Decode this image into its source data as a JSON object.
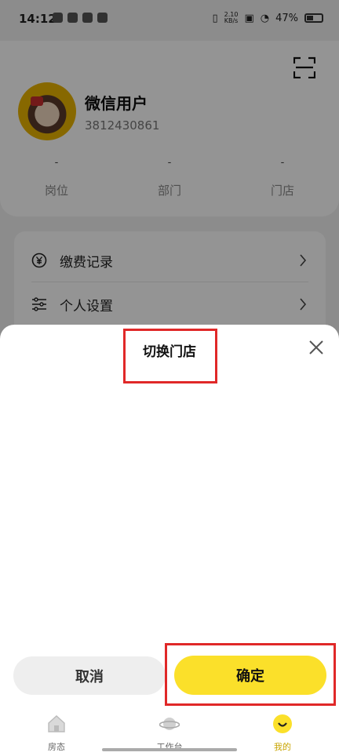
{
  "status_bar": {
    "time": "14:12",
    "net_speed": "2.10\nKB/s",
    "battery": "47%"
  },
  "profile": {
    "name": "微信用户",
    "id": "3812430861",
    "stats": [
      {
        "value": "-",
        "label": "岗位"
      },
      {
        "value": "-",
        "label": "部门"
      },
      {
        "value": "-",
        "label": "门店"
      }
    ]
  },
  "menu": [
    {
      "label": "缴费记录",
      "icon": "yen-circle-icon"
    },
    {
      "label": "个人设置",
      "icon": "sliders-icon"
    }
  ],
  "sheet": {
    "title": "切换门店",
    "cancel_label": "取消",
    "confirm_label": "确定"
  },
  "tabbar": [
    {
      "label": "房态",
      "icon": "house-icon",
      "active": false
    },
    {
      "label": "工作台",
      "icon": "planet-icon",
      "active": false
    },
    {
      "label": "我的",
      "icon": "smile-icon",
      "active": true
    }
  ],
  "colors": {
    "accent": "#fbe02a",
    "highlight_box": "#e02828",
    "active_tab": "#c8a400"
  }
}
